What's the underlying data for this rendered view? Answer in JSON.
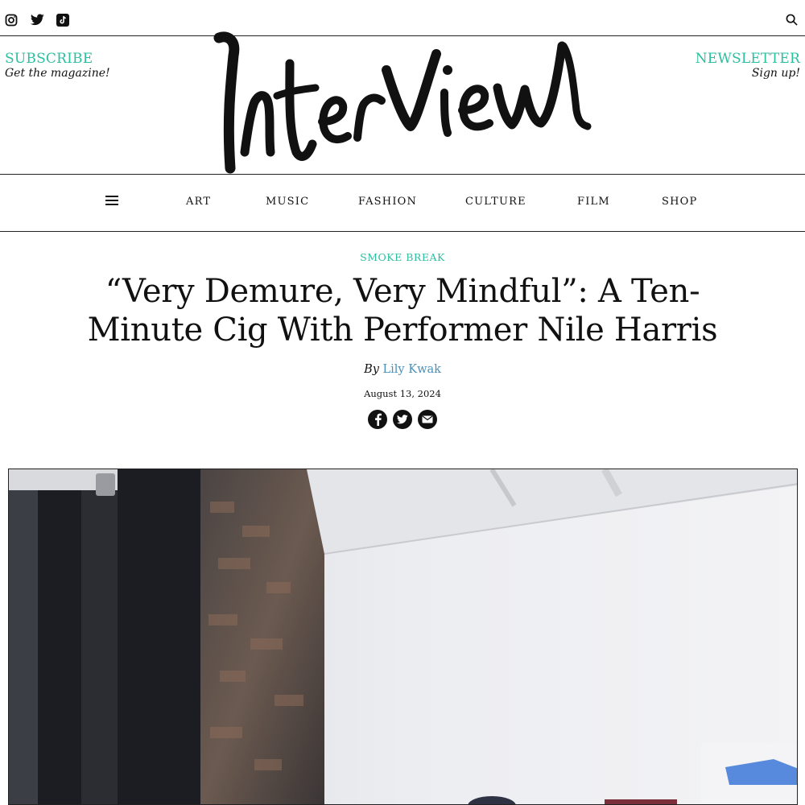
{
  "header": {
    "social_icons": [
      "instagram-icon",
      "twitter-icon",
      "tiktok-icon"
    ],
    "search_icon": "search-icon"
  },
  "masthead": {
    "subscribe_label": "SUBSCRIBE",
    "subscribe_sub": "Get the magazine!",
    "newsletter_label": "NEWSLETTER",
    "newsletter_sub": "Sign up!",
    "logo_text": "Interview"
  },
  "nav": {
    "menu_icon": "hamburger-icon",
    "items": [
      "ART",
      "MUSIC",
      "FASHION",
      "CULTURE",
      "FILM",
      "SHOP"
    ]
  },
  "article": {
    "kicker": "SMOKE BREAK",
    "headline": "“Very Demure, Very Mindful”: A Ten-Minute Cig With Performer Nile Harris",
    "by": "By",
    "author": "Lily Kwak",
    "date": "August 13, 2024",
    "share_icons": [
      "facebook-icon",
      "twitter-icon",
      "email-icon"
    ]
  },
  "colors": {
    "accent": "#2bbfa0",
    "author_link": "#4a90b8",
    "text": "#111111"
  }
}
